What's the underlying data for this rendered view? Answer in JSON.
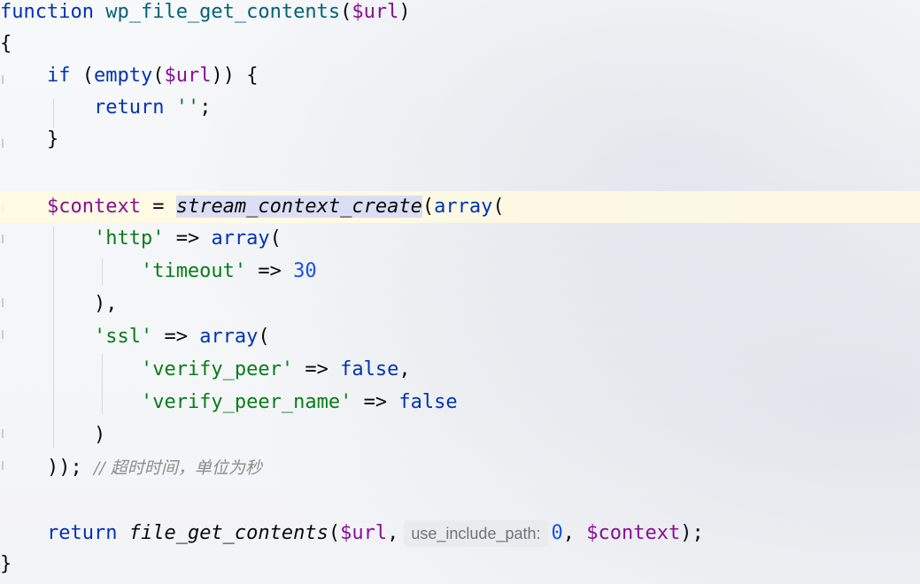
{
  "code": {
    "l1_kw": "function",
    "l1_name": "wp_file_get_contents",
    "l1_open": "(",
    "l1_var": "$url",
    "l1_close": ")",
    "l2": "{",
    "l3_kw": "if",
    "l3_a": " (",
    "l3_fn": "empty",
    "l3_b": "(",
    "l3_var": "$url",
    "l3_c": ")) {",
    "l4_kw": "return",
    "l4_str": "''",
    "l4_end": ";",
    "l5": "}",
    "l7_var": "$context",
    "l7_eq": " = ",
    "l7_call": "stream_context_create",
    "l7_open": "(",
    "l7_arr": "array",
    "l7_paren": "(",
    "l8_str": "'http'",
    "l8_arrow": " => ",
    "l8_arr": "array",
    "l8_paren": "(",
    "l9_str": "'timeout'",
    "l9_arrow": " => ",
    "l9_num": "30",
    "l10": "),",
    "l11_str": "'ssl'",
    "l11_arrow": " => ",
    "l11_arr": "array",
    "l11_paren": "(",
    "l12_str": "'verify_peer'",
    "l12_arrow": " => ",
    "l12_kw": "false",
    "l12_comma": ",",
    "l13_str": "'verify_peer_name'",
    "l13_arrow": " => ",
    "l13_kw": "false",
    "l14": ")",
    "l15_close": "));",
    "l15_comment": "// 超时时间，单位为秒",
    "l17_kw": "return",
    "l17_call": "file_get_contents",
    "l17_open": "(",
    "l17_var": "$url",
    "l17_comma": ",",
    "l17_hint": "use_include_path:",
    "l17_num": "0",
    "l17_sep": ", ",
    "l17_var2": "$context",
    "l17_end": ");",
    "l18": "}"
  }
}
